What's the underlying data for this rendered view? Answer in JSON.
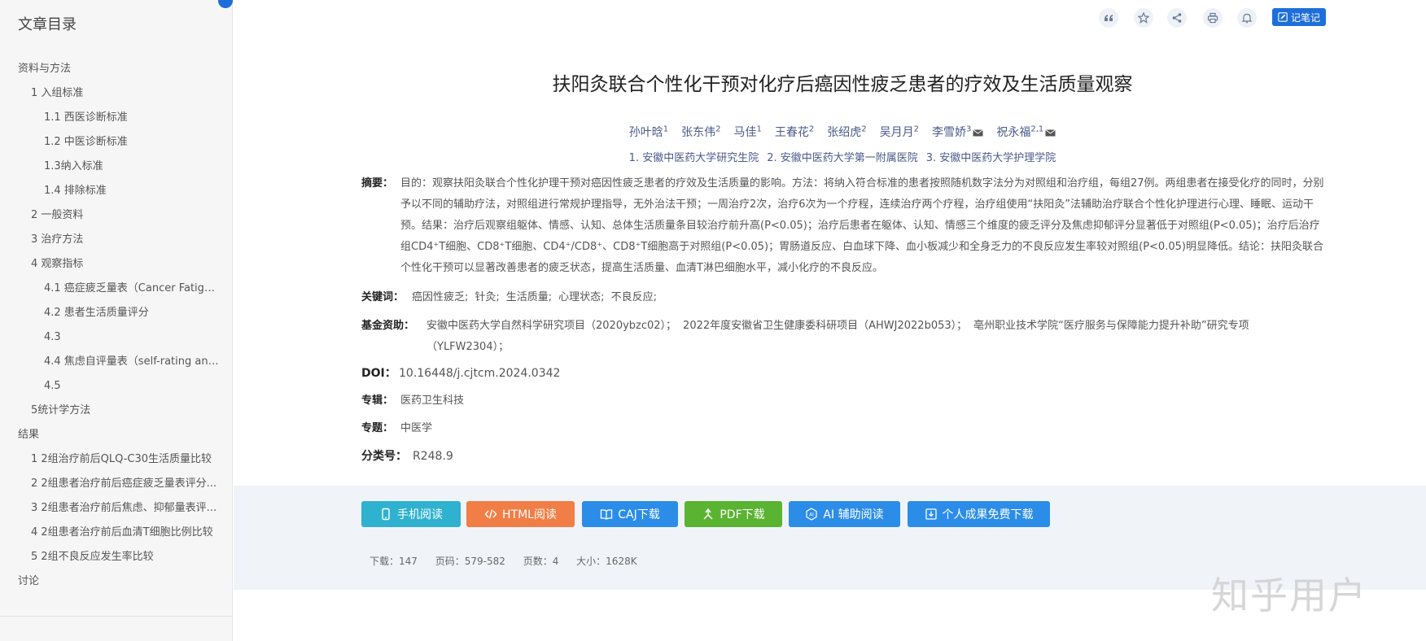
{
  "sidebar": {
    "title": "文章目录",
    "items": [
      {
        "label": "资料与方法",
        "level": 0
      },
      {
        "label": "1 入组标准",
        "level": 1
      },
      {
        "label": "1.1 西医诊断标准",
        "level": 2
      },
      {
        "label": "1.2 中医诊断标准",
        "level": 2
      },
      {
        "label": "1.3纳入标准",
        "level": 2
      },
      {
        "label": "1.4 排除标准",
        "level": 2
      },
      {
        "label": "2 一般资料",
        "level": 1
      },
      {
        "label": "3 治疗方法",
        "level": 1
      },
      {
        "label": "4 观察指标",
        "level": 1
      },
      {
        "label": "4.1 癌症疲乏量表（Cancer Fatigue...",
        "level": 2
      },
      {
        "label": "4.2 患者生活质量评分",
        "level": 2
      },
      {
        "label": "4.3",
        "level": 2
      },
      {
        "label": "4.4 焦虑自评量表（self-rating anxi...",
        "level": 2
      },
      {
        "label": "4.5",
        "level": 2
      },
      {
        "label": "5统计学方法",
        "level": 1
      },
      {
        "label": "结果",
        "level": 0
      },
      {
        "label": "1 2组治疗前后QLQ-C30生活质量比较",
        "level": 1
      },
      {
        "label": "2 2组患者治疗前后癌症疲乏量表评分...",
        "level": 1
      },
      {
        "label": "3 2组患者治疗前后焦虑、抑郁量表评...",
        "level": 1
      },
      {
        "label": "4 2组患者治疗前后血清T细胞比例比较",
        "level": 1
      },
      {
        "label": "5 2组不良反应发生率比较",
        "level": 1
      },
      {
        "label": "讨论",
        "level": 0
      }
    ]
  },
  "toolbar": {
    "icons": [
      "quote-icon",
      "star-icon",
      "share-icon",
      "print-icon",
      "bell-icon"
    ],
    "note_label": "记笔记"
  },
  "article": {
    "title": "扶阳灸联合个性化干预对化疗后癌因性疲乏患者的疗效及生活质量观察",
    "authors": [
      {
        "name": "孙叶晗",
        "sup": "1",
        "mail": false
      },
      {
        "name": "张东伟",
        "sup": "2",
        "mail": false
      },
      {
        "name": "马佳",
        "sup": "1",
        "mail": false
      },
      {
        "name": "王春花",
        "sup": "2",
        "mail": false
      },
      {
        "name": "张绍虎",
        "sup": "2",
        "mail": false
      },
      {
        "name": "吴月月",
        "sup": "2",
        "mail": false
      },
      {
        "name": "李雪娇",
        "sup": "3",
        "mail": true
      },
      {
        "name": "祝永福",
        "sup": "2,1",
        "mail": true
      }
    ],
    "affiliations": [
      "1. 安徽中医药大学研究生院",
      "2. 安徽中医药大学第一附属医院",
      "3. 安徽中医药大学护理学院"
    ],
    "abstract_label": "摘要：",
    "abstract": "目的：观察扶阳灸联合个性化护理干预对癌因性疲乏患者的疗效及生活质量的影响。方法：将纳入符合标准的患者按照随机数字法分为对照组和治疗组，每组27例。两组患者在接受化疗的同时，分别予以不同的辅助疗法，对照组进行常规护理指导，无外治法干预；一周治疗2次，治疗6次为一个疗程，连续治疗两个疗程，治疗组使用“扶阳灸”法辅助治疗联合个性化护理进行心理、睡眠、运动干预。结果：治疗后观察组躯体、情感、认知、总体生活质量条目较治疗前升高(P<0.05)；治疗后患者在躯体、认知、情感三个维度的疲乏评分及焦虑抑郁评分显著低于对照组(P<0.05)；治疗后治疗组CD4⁺T细胞、CD8⁺T细胞、CD4⁺/CD8⁺、CD8⁺T细胞高于对照组(P<0.05)；胃肠道反应、白血球下降、血小板减少和全身乏力的不良反应发生率较对照组(P<0.05)明显降低。结论：扶阳灸联合个性化干预可以显著改善患者的疲乏状态，提高生活质量、血清T淋巴细胞水平，减小化疗的不良反应。",
    "keywords_label": "关键词：",
    "keywords": [
      "癌因性疲乏;",
      "针灸;",
      "生活质量;",
      "心理状态;",
      "不良反应;"
    ],
    "fund_label": "基金资助：",
    "funds": [
      "安徽中医药大学自然科学研究项目（2020ybzc02）；",
      "2022年度安徽省卫生健康委科研项目（AHWJ2022b053）；",
      "亳州职业技术学院“医疗服务与保障能力提升补助”研究专项（YLFW2304）；"
    ],
    "doi_label": "DOI：",
    "doi": "10.16448/j.cjtcm.2024.0342",
    "album_label": "专辑：",
    "album": "医药卫生科技",
    "topic_label": "专题：",
    "topic": "中医学",
    "class_label": "分类号：",
    "class": "R248.9"
  },
  "downloads": [
    {
      "label": "手机阅读",
      "color": "#2fb2cf",
      "icon": "phone-icon"
    },
    {
      "label": "HTML阅读",
      "color": "#f07e46",
      "icon": "code-icon"
    },
    {
      "label": "CAJ下载",
      "color": "#2c8de8",
      "icon": "book-icon"
    },
    {
      "label": "PDF下载",
      "color": "#5ab331",
      "icon": "pdf-icon"
    },
    {
      "label": "AI 辅助阅读",
      "color": "#2c8de8",
      "icon": "ai-icon"
    },
    {
      "label": "个人成果免费下载",
      "color": "#2c8de8",
      "icon": "download-icon"
    }
  ],
  "stats": {
    "downloads": "下载：147",
    "pages_range": "页码：579-582",
    "page_count": "页数：4",
    "size": "大小：1628K"
  },
  "watermark": "知乎用户"
}
